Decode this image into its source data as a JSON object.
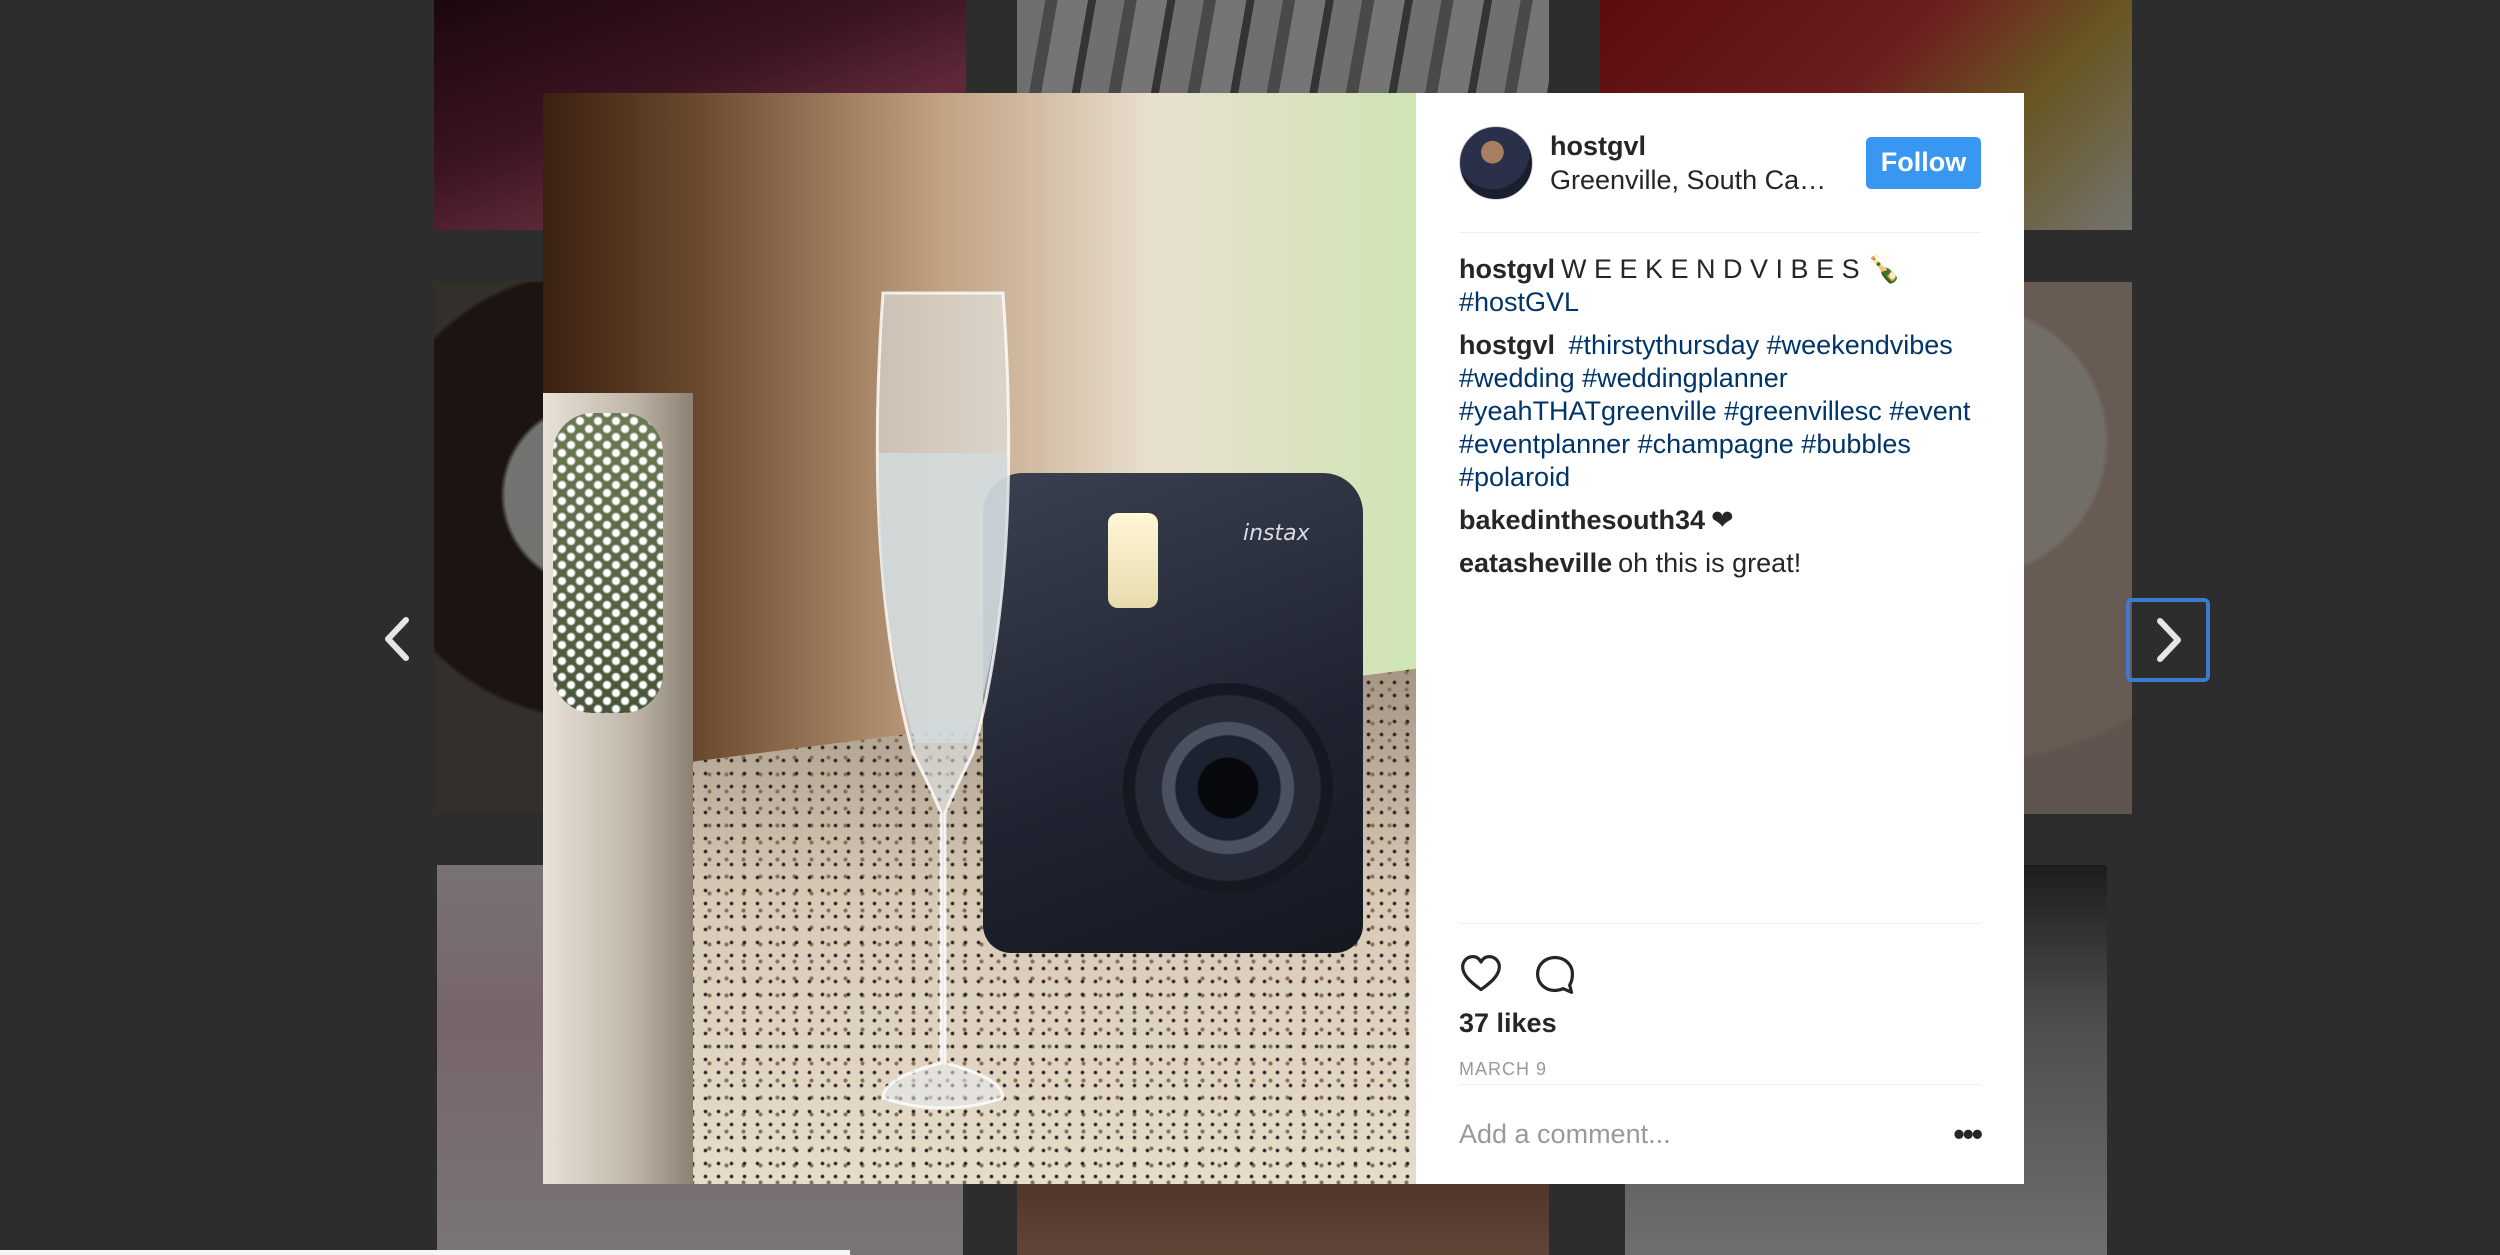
{
  "post": {
    "username": "hostgvl",
    "location": "Greenville, South Carolina",
    "follow_label": "Follow",
    "caption_author": "hostgvl",
    "caption_text": "W E E K E N D V I B E S 🍾",
    "caption_tag": "#hostGVL",
    "comments": [
      {
        "author": "hostgvl",
        "tags": [
          "#thirstythursday",
          "#weekendvibes",
          "#wedding",
          "#weddingplanner",
          "#yeahTHATgreenville",
          "#greenvillesc",
          "#event",
          "#eventplanner",
          "#champagne",
          "#bubbles",
          "#polaroid"
        ]
      },
      {
        "author": "bakedinthesouth34",
        "text": "❤"
      },
      {
        "author": "eatasheville",
        "text": "oh this is great!"
      }
    ],
    "likes": "37 likes",
    "date": "MARCH 9",
    "comment_placeholder": "Add a comment...",
    "more_label": "•••",
    "photo_brand": "instax"
  },
  "icons": {
    "like": "heart-icon",
    "comment": "comment-bubble-icon",
    "prev": "chevron-left-icon",
    "next": "chevron-right-icon"
  },
  "colors": {
    "follow_button": "#3897f0",
    "hashtag": "#003569",
    "next_focus": "#3d7bd0"
  }
}
